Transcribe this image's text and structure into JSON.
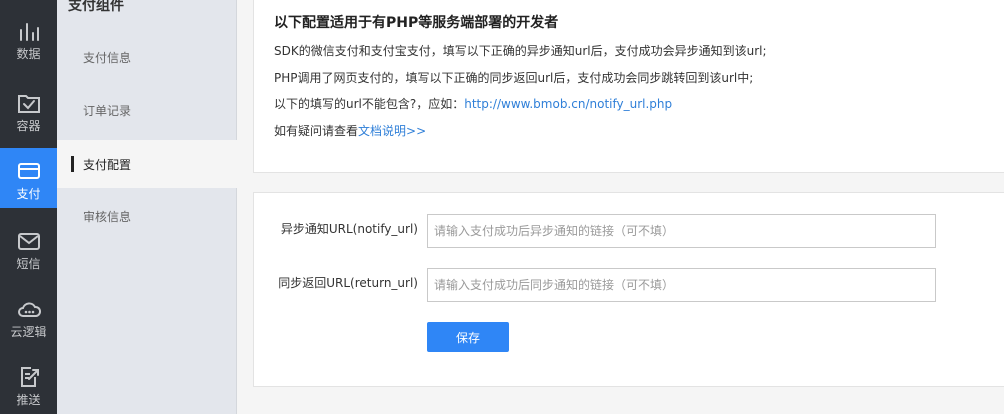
{
  "rail": {
    "items": [
      {
        "label": "数据",
        "icon": "bar-chart-icon"
      },
      {
        "label": "容器",
        "icon": "container-check-icon"
      },
      {
        "label": "支付",
        "icon": "card-icon"
      },
      {
        "label": "短信",
        "icon": "mail-icon"
      },
      {
        "label": "云逻辑",
        "icon": "cloud-icon"
      },
      {
        "label": "推送",
        "icon": "push-doc-icon"
      }
    ],
    "active_index": 2
  },
  "submenu": {
    "title": "支付组件",
    "items": [
      {
        "label": "支付信息"
      },
      {
        "label": "订单记录"
      },
      {
        "label": "支付配置"
      },
      {
        "label": "审核信息"
      }
    ],
    "active_index": 2
  },
  "notice": {
    "title": "以下配置适用于有PHP等服务端部署的开发者",
    "line1": "SDK的微信支付和支付宝支付，填写以下正确的异步通知url后，支付成功会异步通知到该url;",
    "line2": "PHP调用了网页支付的，填写以下正确的同步返回url后，支付成功会同步跳转回到该url中;",
    "line3_prefix": "以下的填写的url不能包含?，应如：",
    "line3_link": "http://www.bmob.cn/notify_url.php",
    "line4_prefix": "如有疑问请查看",
    "line4_link": "文档说明>>"
  },
  "form": {
    "notify": {
      "label": "异步通知URL(notify_url)",
      "placeholder": "请输入支付成功后异步通知的链接（可不填）",
      "value": ""
    },
    "return": {
      "label": "同步返回URL(return_url)",
      "placeholder": "请输入支付成功后同步通知的链接（可不填）",
      "value": ""
    },
    "save_label": "保存"
  },
  "colors": {
    "accent": "#2f86f6",
    "rail_bg": "#2d3137",
    "submenu_bg": "#e3e6ec",
    "link": "#2f7fd8"
  }
}
